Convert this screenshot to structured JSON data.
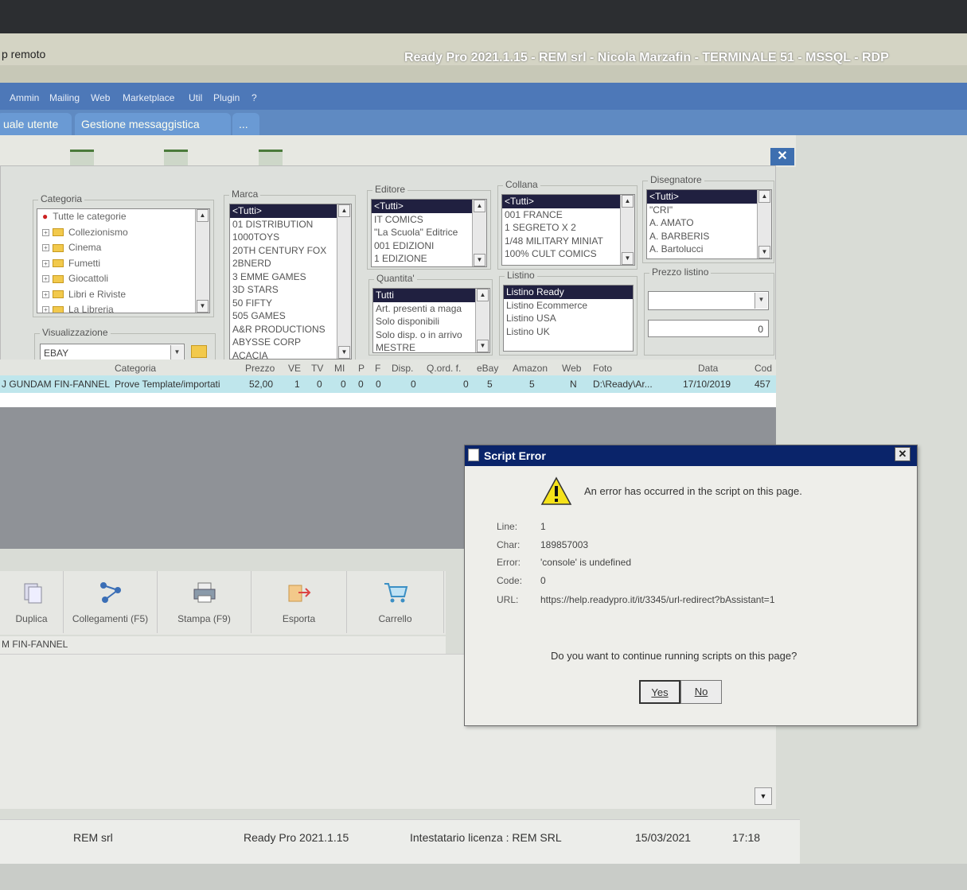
{
  "rdp": {
    "left_label": "p remoto",
    "title": "Ready Pro 2021.1.15 - REM srl - Nicola Marzafin - TERMINALE 51 - MSSQL - RDP"
  },
  "menu": [
    "Ammin",
    "Mailing",
    "Web",
    "Marketplace",
    "Util",
    "Plugin",
    "?"
  ],
  "tabs": [
    "uale utente",
    "Gestione messaggistica",
    "..."
  ],
  "filters": {
    "categoria": {
      "label": "Categoria",
      "items": [
        "Tutte le categorie",
        "Collezionismo",
        "Cinema",
        "Fumetti",
        "Giocattoli",
        "Libri e Riviste",
        "La Libreria"
      ]
    },
    "visualizzazione": {
      "label": "Visualizzazione",
      "value": "EBAY"
    },
    "marca": {
      "label": "Marca",
      "items": [
        "<Tutti>",
        "01 DISTRIBUTION",
        "1000TOYS",
        "20TH CENTURY FOX",
        "2BNERD",
        "3 EMME GAMES",
        "3D STARS",
        "50 FIFTY",
        "505 GAMES",
        "A&R PRODUCTIONS",
        "ABYSSE CORP",
        "ACACIA"
      ]
    },
    "editore": {
      "label": "Editore",
      "items": [
        "<Tutti>",
        "IT COMICS",
        "\"La Scuola\" Editrice",
        "001 EDIZIONI",
        "1 EDIZIONE"
      ]
    },
    "collana": {
      "label": "Collana",
      "items": [
        "<Tutti>",
        "001 FRANCE",
        "1 SEGRETO X 2",
        "1/48 MILITARY MINIAT",
        "100% CULT COMICS"
      ]
    },
    "disegnatore": {
      "label": "Disegnatore",
      "items": [
        "<Tutti>",
        "\"CRI\"",
        "A. AMATO",
        "A. BARBERIS",
        "A. Bartolucci"
      ]
    },
    "quantita": {
      "label": "Quantita'",
      "items": [
        "Tutti",
        "Art. presenti a maga",
        "Solo disponibili",
        "Solo disp. o in arrivo",
        "MESTRE"
      ]
    },
    "listino": {
      "label": "Listino",
      "items": [
        "Listino Ready",
        "Listino Ecommerce",
        "Listino USA",
        "Listino UK"
      ]
    },
    "prezzo_listino": {
      "label": "Prezzo listino",
      "value": "0"
    }
  },
  "grid": {
    "headers": [
      "Categoria",
      "Prezzo",
      "VE",
      "TV",
      "MI",
      "P",
      "F",
      "Disp.",
      "Q.ord. f.",
      "eBay",
      "Amazon",
      "Web",
      "Foto",
      "Data",
      "Cod"
    ],
    "row": [
      "J GUNDAM FIN-FANNEL",
      "Prove Template/importati",
      "52,00",
      "1",
      "0",
      "0",
      "0",
      "0",
      "0",
      "0",
      "5",
      "5",
      "N",
      "D:\\Ready\\Ar...",
      "17/10/2019",
      "457"
    ]
  },
  "actions": [
    "Duplica",
    "Collegamenti (F5)",
    "Stampa (F9)",
    "Esporta",
    "Carrello"
  ],
  "selected_label": "M FIN-FANNEL",
  "status": {
    "company": "REM srl",
    "version": "Ready Pro 2021.1.15",
    "license": "Intestatario licenza : REM SRL",
    "date": "15/03/2021",
    "time": "17:18"
  },
  "dialog": {
    "title": "Script Error",
    "message": "An error has occurred in the script on this page.",
    "fields": [
      {
        "label": "Line:",
        "value": "1"
      },
      {
        "label": "Char:",
        "value": "189857003"
      },
      {
        "label": "Error:",
        "value": "'console' is undefined"
      },
      {
        "label": "Code:",
        "value": "0"
      },
      {
        "label": "URL:",
        "value": "https://help.readypro.it/it/3345/url-redirect?bAssistant=1"
      }
    ],
    "question": "Do you want to continue running scripts on this page?",
    "yes": "Yes",
    "no": "No"
  }
}
